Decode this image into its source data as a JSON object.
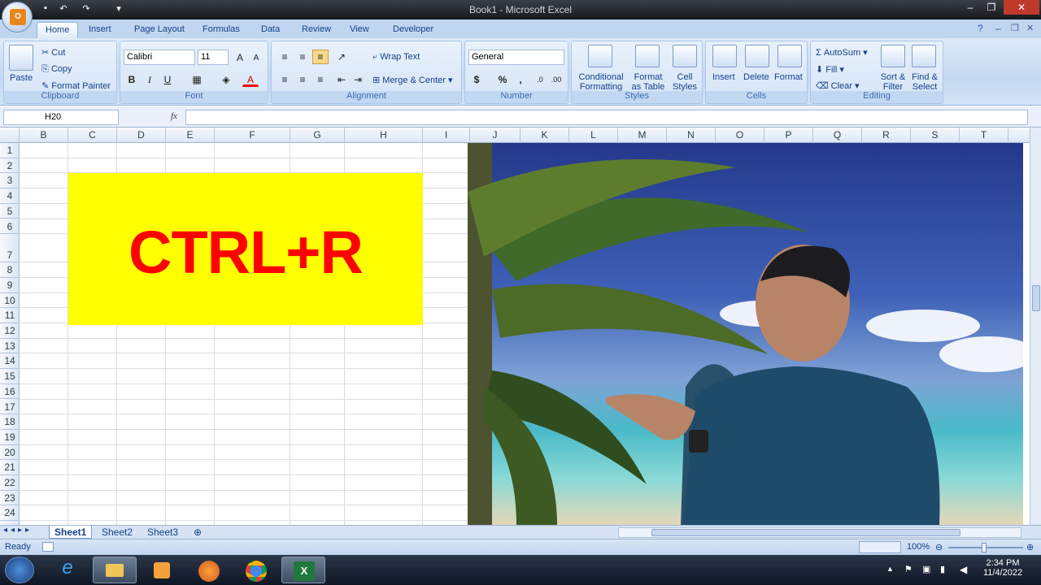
{
  "window": {
    "title": "Book1 - Microsoft Excel"
  },
  "ribbon": {
    "tabs": [
      "Home",
      "Insert",
      "Page Layout",
      "Formulas",
      "Data",
      "Review",
      "View",
      "Developer"
    ],
    "clipboard": {
      "label": "Clipboard",
      "paste": "Paste",
      "cut": "Cut",
      "copy": "Copy",
      "format_painter": "Format Painter"
    },
    "font": {
      "label": "Font",
      "name": "Calibri",
      "size": "11",
      "bold": "B",
      "italic": "I",
      "underline": "U"
    },
    "alignment": {
      "label": "Alignment",
      "wrap": "Wrap Text",
      "merge": "Merge & Center"
    },
    "number": {
      "label": "Number",
      "format": "General",
      "currency": "$",
      "percent": "%",
      "comma": ","
    },
    "styles": {
      "label": "Styles",
      "conditional": [
        "Conditional",
        "Formatting"
      ],
      "format_table": [
        "Format",
        "as Table"
      ],
      "cell_styles": [
        "Cell",
        "Styles"
      ]
    },
    "cells": {
      "label": "Cells",
      "insert": "Insert",
      "delete": "Delete",
      "format": "Format"
    },
    "editing": {
      "label": "Editing",
      "autosum": "AutoSum",
      "fill": "Fill",
      "clear": "Clear",
      "sort": [
        "Sort &",
        "Filter"
      ],
      "find": [
        "Find &",
        "Select"
      ]
    }
  },
  "formula_bar": {
    "name_box": "H20",
    "fx": "fx",
    "value": ""
  },
  "columns": [
    "B",
    "C",
    "D",
    "E",
    "F",
    "G",
    "H",
    "I",
    "J",
    "K",
    "L",
    "M",
    "N",
    "O",
    "P",
    "Q",
    "R",
    "S",
    "T"
  ],
  "rows": [
    "1",
    "2",
    "3",
    "4",
    "5",
    "6",
    "7",
    "8",
    "9",
    "10",
    "11",
    "12",
    "13",
    "14",
    "15",
    "16",
    "17",
    "18",
    "19",
    "20",
    "21",
    "22",
    "23",
    "24"
  ],
  "cell_text": "CTRL+R",
  "sheets": [
    "Sheet1",
    "Sheet2",
    "Sheet3"
  ],
  "status": {
    "ready": "Ready",
    "zoom": "100%"
  },
  "taskbar": {
    "time": "2:34 PM",
    "date": "11/4/2022"
  },
  "colors": {
    "highlight": "#ffff00",
    "text_red": "#ff0000"
  }
}
